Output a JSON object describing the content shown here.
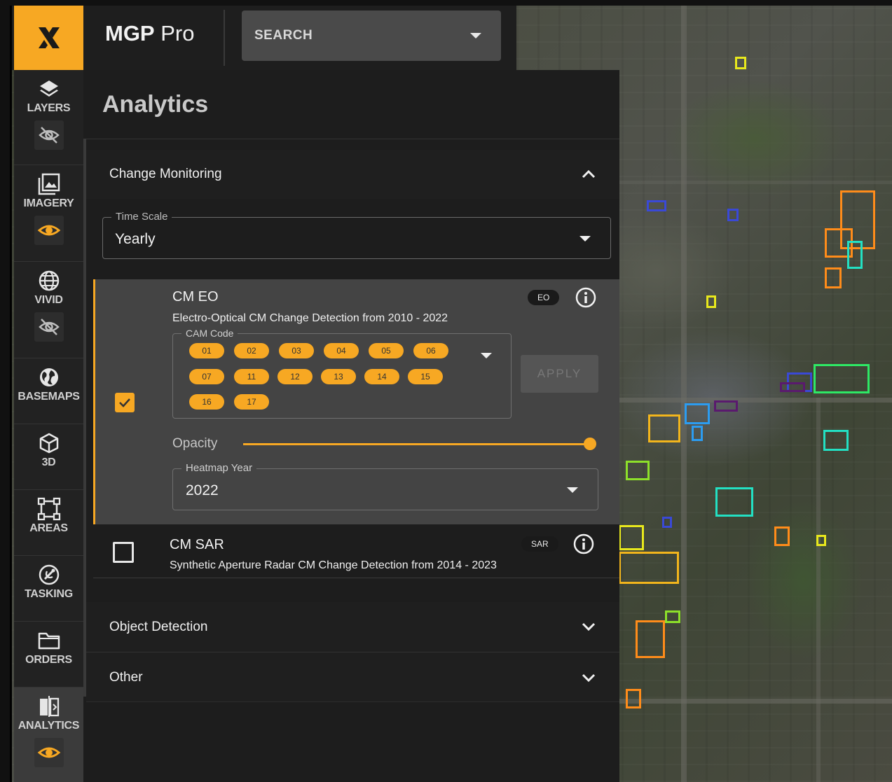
{
  "app": {
    "brand": "MGP",
    "product": "Pro",
    "logo_icon": "x-logo-icon",
    "accent": "#f7a823"
  },
  "search": {
    "label": "SEARCH"
  },
  "nav": [
    {
      "label": "LAYERS",
      "icon": "layers-icon",
      "visibility": "hidden"
    },
    {
      "label": "IMAGERY",
      "icon": "imagery-icon",
      "visibility": "visible"
    },
    {
      "label": "VIVID",
      "icon": "globe-icon",
      "visibility": "hidden"
    },
    {
      "label": "BASEMAPS",
      "icon": "basemaps-icon"
    },
    {
      "label": "3D",
      "icon": "cube-icon"
    },
    {
      "label": "AREAS",
      "icon": "areas-icon"
    },
    {
      "label": "TASKING",
      "icon": "tasking-icon"
    },
    {
      "label": "ORDERS",
      "icon": "folder-icon"
    },
    {
      "label": "ANALYTICS",
      "icon": "analytics-icon",
      "visibility": "visible",
      "active": true
    }
  ],
  "panel": {
    "title": "Analytics",
    "sections": {
      "change_monitoring": "Change Monitoring",
      "object_detection": "Object Detection",
      "other": "Other"
    },
    "time_scale": {
      "label": "Time Scale",
      "value": "Yearly"
    },
    "cm_eo": {
      "title": "CM EO",
      "badge": "EO",
      "description": "Electro-Optical CM Change Detection from 2010 - 2022",
      "checked": true,
      "cam_code_label": "CAM Code",
      "cam_codes": [
        "01",
        "02",
        "03",
        "04",
        "05",
        "06",
        "07",
        "11",
        "12",
        "13",
        "14",
        "15",
        "16",
        "17"
      ],
      "apply_label": "APPLY",
      "opacity_label": "Opacity",
      "opacity": 1.0,
      "heatmap_label": "Heatmap Year",
      "heatmap_year": "2022"
    },
    "cm_sar": {
      "title": "CM SAR",
      "badge": "SAR",
      "description": "Synthetic Aperture Radar CM Change Detection from 2014 - 2023",
      "checked": false
    }
  }
}
